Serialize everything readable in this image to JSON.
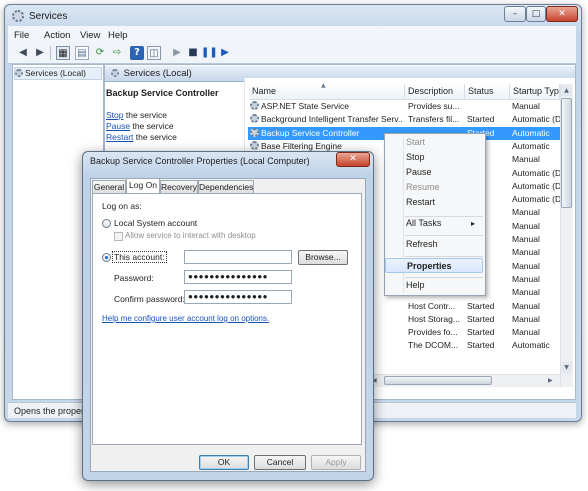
{
  "window": {
    "title": "Services",
    "caption_buttons": [
      "–",
      "□",
      "✕"
    ]
  },
  "menubar": [
    "File",
    "Action",
    "View",
    "Help"
  ],
  "toolbar_icons": [
    "back-arrow-icon",
    "forward-arrow-icon",
    "console-tree-icon",
    "properties-icon",
    "refresh-icon",
    "export-icon",
    "help-icon",
    "mmc-view-icon",
    "start-service-icon",
    "stop-service-icon",
    "pause-service-icon",
    "resume-service-icon"
  ],
  "tree": {
    "root_label": "Services (Local)"
  },
  "pane_header": "Services (Local)",
  "detail": {
    "title": "Backup Service Controller",
    "links": [
      {
        "link": "Stop",
        "rest": " the service"
      },
      {
        "link": "Pause",
        "rest": " the service"
      },
      {
        "link": "Restart",
        "rest": " the service"
      }
    ]
  },
  "grid": {
    "columns": [
      "Name",
      "Description",
      "Status",
      "Startup Type"
    ],
    "rows": [
      {
        "name": "ASP.NET State Service",
        "desc": "Provides su...",
        "status": "",
        "startup": "Manual",
        "selected": false
      },
      {
        "name": "Background Intelligent Transfer Serv...",
        "desc": "Transfers fil...",
        "status": "Started",
        "startup": "Automatic (D",
        "selected": false
      },
      {
        "name": "Backup Service Controller",
        "desc": "",
        "status": "Started",
        "startup": "Automatic",
        "selected": true
      },
      {
        "name": "Base Filtering Engine",
        "desc": "",
        "status": "",
        "startup": "Automatic",
        "selected": false
      },
      {
        "name": "",
        "desc": "",
        "status": "",
        "startup": "Manual",
        "selected": false
      },
      {
        "name": "",
        "desc": "",
        "status": "",
        "startup": "Automatic (D",
        "selected": false
      },
      {
        "name": "",
        "desc": "",
        "status": "",
        "startup": "Automatic (D",
        "selected": false
      },
      {
        "name": "",
        "desc": "",
        "status": "",
        "startup": "Automatic (D",
        "selected": false
      },
      {
        "name": "",
        "desc": "",
        "status": "",
        "startup": "Manual",
        "selected": false
      },
      {
        "name": "",
        "desc": "",
        "status": "",
        "startup": "Manual",
        "selected": false
      },
      {
        "name": "",
        "desc": "",
        "status": "",
        "startup": "Manual",
        "selected": false
      },
      {
        "name": "",
        "desc": "",
        "status": "",
        "startup": "Manual",
        "selected": false
      },
      {
        "name": "",
        "desc": "",
        "status": "",
        "startup": "Manual",
        "selected": false
      },
      {
        "name": "",
        "desc": "Maintains a...",
        "status": "",
        "startup": "Manual",
        "selected": false
      },
      {
        "name": "",
        "desc": "Provides se...",
        "status": "",
        "startup": "Manual",
        "selected": false
      },
      {
        "name": "Service",
        "desc": "Host Contr...",
        "status": "Started",
        "startup": "Manual",
        "selected": false
      },
      {
        "name": "",
        "desc": "Host Storag...",
        "status": "Started",
        "startup": "Manual",
        "selected": false
      },
      {
        "name": "",
        "desc": "Provides fo...",
        "status": "Started",
        "startup": "Manual",
        "selected": false
      },
      {
        "name": "er",
        "desc": "The DCOM...",
        "status": "Started",
        "startup": "Automatic",
        "selected": false
      }
    ]
  },
  "context_menu": {
    "items": [
      {
        "label": "Start",
        "disabled": true,
        "highlight": false
      },
      {
        "label": "Stop",
        "disabled": false,
        "highlight": false
      },
      {
        "label": "Pause",
        "disabled": false,
        "highlight": false
      },
      {
        "label": "Resume",
        "disabled": true,
        "highlight": false
      },
      {
        "label": "Restart",
        "disabled": false,
        "highlight": false
      },
      {
        "label": "All Tasks",
        "disabled": false,
        "highlight": false,
        "submenu": "▸"
      },
      {
        "label": "Refresh",
        "disabled": false,
        "highlight": false
      },
      {
        "label": "Properties",
        "disabled": false,
        "highlight": true
      },
      {
        "label": "Help",
        "disabled": false,
        "highlight": false
      }
    ]
  },
  "statusbar": "Opens the propert",
  "dialog": {
    "title": "Backup Service Controller Properties (Local Computer)",
    "close_glyph": "✕",
    "tabs": [
      "General",
      "Log On",
      "Recovery",
      "Dependencies"
    ],
    "active_tab": "Log On",
    "logon_as": "Log on as:",
    "local_system": "Local System account",
    "allow_interact": "Allow service to interact with desktop",
    "this_account": "This account:",
    "this_account_value": "",
    "browse": "Browse...",
    "password_label": "Password:",
    "password_value": "●●●●●●●●●●●●●●●",
    "confirm_label": "Confirm password:",
    "confirm_value": "●●●●●●●●●●●●●●●",
    "help_link": "Help me configure user account log on options.",
    "ok": "OK",
    "cancel": "Cancel",
    "apply": "Apply"
  }
}
